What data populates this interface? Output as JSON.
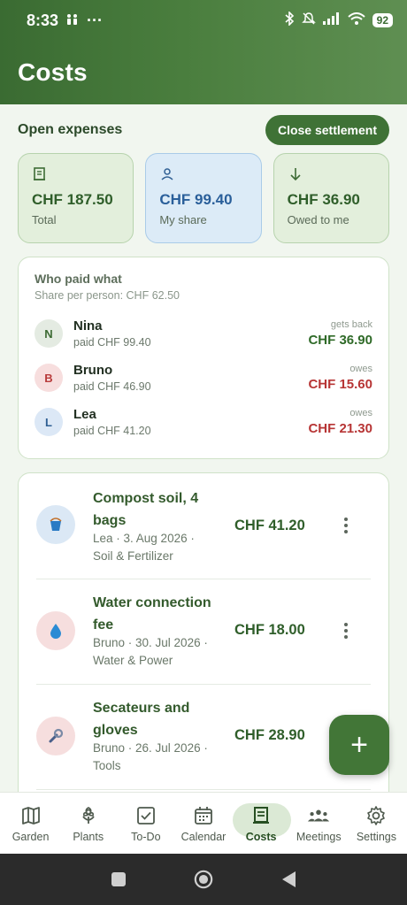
{
  "status_bar": {
    "time": "8:33",
    "battery": "92"
  },
  "header": {
    "title": "Costs"
  },
  "open_expenses": {
    "title": "Open expenses",
    "close_button": "Close settlement"
  },
  "summary": [
    {
      "amount": "CHF 187.50",
      "label": "Total",
      "icon": "receipt-icon"
    },
    {
      "amount": "CHF 99.40",
      "label": "My share",
      "icon": "person-icon"
    },
    {
      "amount": "CHF 36.90",
      "label": "Owed to me",
      "icon": "arrow-down-icon"
    }
  ],
  "who_paid": {
    "title": "Who paid what",
    "subtitle": "Share per person: CHF 62.50",
    "people": [
      {
        "initial": "N",
        "name": "Nina",
        "paid": "paid CHF 99.40",
        "tag": "gets back",
        "amount": "CHF 36.90"
      },
      {
        "initial": "B",
        "name": "Bruno",
        "paid": "paid CHF 46.90",
        "tag": "owes",
        "amount": "CHF 15.60"
      },
      {
        "initial": "L",
        "name": "Lea",
        "paid": "paid CHF 41.20",
        "tag": "owes",
        "amount": "CHF 21.30"
      }
    ]
  },
  "expenses": [
    {
      "title": "Compost soil, 4 bags",
      "meta": "Lea · 3. Aug 2026 · Soil & Fertilizer",
      "amount": "CHF 41.20",
      "icon": "bucket-icon"
    },
    {
      "title": "Water connection fee",
      "meta": "Bruno · 30. Jul 2026 · Water & Power",
      "amount": "CHF 18.00",
      "icon": "water-drop-icon"
    },
    {
      "title": "Secateurs and gloves",
      "meta": "Bruno · 26. Jul 2026 · Tools",
      "amount": "CHF 28.90",
      "icon": "wrench-icon"
    }
  ],
  "fab": {
    "label": "+"
  },
  "bottom_nav": [
    {
      "label": "Garden"
    },
    {
      "label": "Plants"
    },
    {
      "label": "To-Do"
    },
    {
      "label": "Calendar"
    },
    {
      "label": "Costs",
      "active": true
    },
    {
      "label": "Meetings"
    },
    {
      "label": "Settings"
    }
  ],
  "colors": {
    "accent": "#427637",
    "owes": "#b73535",
    "gets_back": "#2f6a28",
    "share": "#2a5f9a"
  }
}
